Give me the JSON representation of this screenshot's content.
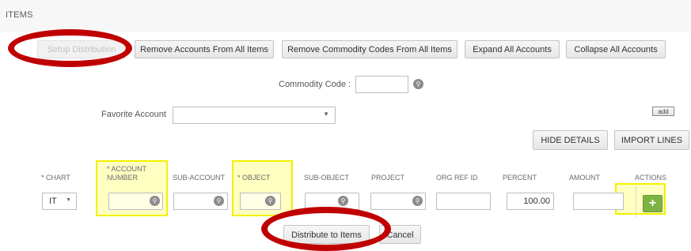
{
  "section": {
    "title": "ITEMS"
  },
  "toolbar": {
    "setup_distribution": "Setup Distribution",
    "remove_accounts": "Remove Accounts From All Items",
    "remove_commodity": "Remove Commodity Codes From All Items",
    "expand_all": "Expand All Accounts",
    "collapse_all": "Collapse All Accounts"
  },
  "commodity": {
    "label": "Commodity Code :",
    "value": ""
  },
  "favorite": {
    "label": "Favorite Account",
    "value": "",
    "add_label": "add"
  },
  "actions": {
    "hide_details": "HIDE DETAILS",
    "import_lines": "IMPORT LINES"
  },
  "columns": {
    "chart": "* CHART",
    "account_number_1": "* ACCOUNT",
    "account_number_2": "NUMBER",
    "sub_account": "SUB-ACCOUNT",
    "object": "* OBJECT",
    "sub_object": "SUB-OBJECT",
    "project": "PROJECT",
    "org_ref_id": "ORG REF ID",
    "percent": "PERCENT",
    "amount": "AMOUNT",
    "actions": "ACTIONS"
  },
  "row": {
    "chart": "IT",
    "percent": "100.00",
    "amount": ""
  },
  "footer": {
    "distribute": "Distribute to Items",
    "cancel": "Cancel"
  },
  "colors": {
    "highlight": "#ffffc2",
    "highlight_border": "#f3f000",
    "annotation": "#c00000",
    "add_button": "#7cb342"
  }
}
